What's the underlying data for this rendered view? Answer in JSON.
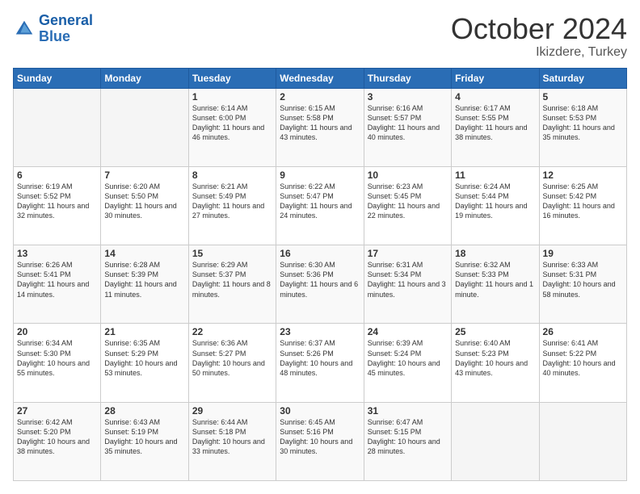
{
  "logo": {
    "line1": "General",
    "line2": "Blue"
  },
  "header": {
    "month": "October 2024",
    "location": "Ikizdere, Turkey"
  },
  "days_of_week": [
    "Sunday",
    "Monday",
    "Tuesday",
    "Wednesday",
    "Thursday",
    "Friday",
    "Saturday"
  ],
  "weeks": [
    [
      {
        "day": "",
        "sunrise": "",
        "sunset": "",
        "daylight": ""
      },
      {
        "day": "",
        "sunrise": "",
        "sunset": "",
        "daylight": ""
      },
      {
        "day": "1",
        "sunrise": "Sunrise: 6:14 AM",
        "sunset": "Sunset: 6:00 PM",
        "daylight": "Daylight: 11 hours and 46 minutes."
      },
      {
        "day": "2",
        "sunrise": "Sunrise: 6:15 AM",
        "sunset": "Sunset: 5:58 PM",
        "daylight": "Daylight: 11 hours and 43 minutes."
      },
      {
        "day": "3",
        "sunrise": "Sunrise: 6:16 AM",
        "sunset": "Sunset: 5:57 PM",
        "daylight": "Daylight: 11 hours and 40 minutes."
      },
      {
        "day": "4",
        "sunrise": "Sunrise: 6:17 AM",
        "sunset": "Sunset: 5:55 PM",
        "daylight": "Daylight: 11 hours and 38 minutes."
      },
      {
        "day": "5",
        "sunrise": "Sunrise: 6:18 AM",
        "sunset": "Sunset: 5:53 PM",
        "daylight": "Daylight: 11 hours and 35 minutes."
      }
    ],
    [
      {
        "day": "6",
        "sunrise": "Sunrise: 6:19 AM",
        "sunset": "Sunset: 5:52 PM",
        "daylight": "Daylight: 11 hours and 32 minutes."
      },
      {
        "day": "7",
        "sunrise": "Sunrise: 6:20 AM",
        "sunset": "Sunset: 5:50 PM",
        "daylight": "Daylight: 11 hours and 30 minutes."
      },
      {
        "day": "8",
        "sunrise": "Sunrise: 6:21 AM",
        "sunset": "Sunset: 5:49 PM",
        "daylight": "Daylight: 11 hours and 27 minutes."
      },
      {
        "day": "9",
        "sunrise": "Sunrise: 6:22 AM",
        "sunset": "Sunset: 5:47 PM",
        "daylight": "Daylight: 11 hours and 24 minutes."
      },
      {
        "day": "10",
        "sunrise": "Sunrise: 6:23 AM",
        "sunset": "Sunset: 5:45 PM",
        "daylight": "Daylight: 11 hours and 22 minutes."
      },
      {
        "day": "11",
        "sunrise": "Sunrise: 6:24 AM",
        "sunset": "Sunset: 5:44 PM",
        "daylight": "Daylight: 11 hours and 19 minutes."
      },
      {
        "day": "12",
        "sunrise": "Sunrise: 6:25 AM",
        "sunset": "Sunset: 5:42 PM",
        "daylight": "Daylight: 11 hours and 16 minutes."
      }
    ],
    [
      {
        "day": "13",
        "sunrise": "Sunrise: 6:26 AM",
        "sunset": "Sunset: 5:41 PM",
        "daylight": "Daylight: 11 hours and 14 minutes."
      },
      {
        "day": "14",
        "sunrise": "Sunrise: 6:28 AM",
        "sunset": "Sunset: 5:39 PM",
        "daylight": "Daylight: 11 hours and 11 minutes."
      },
      {
        "day": "15",
        "sunrise": "Sunrise: 6:29 AM",
        "sunset": "Sunset: 5:37 PM",
        "daylight": "Daylight: 11 hours and 8 minutes."
      },
      {
        "day": "16",
        "sunrise": "Sunrise: 6:30 AM",
        "sunset": "Sunset: 5:36 PM",
        "daylight": "Daylight: 11 hours and 6 minutes."
      },
      {
        "day": "17",
        "sunrise": "Sunrise: 6:31 AM",
        "sunset": "Sunset: 5:34 PM",
        "daylight": "Daylight: 11 hours and 3 minutes."
      },
      {
        "day": "18",
        "sunrise": "Sunrise: 6:32 AM",
        "sunset": "Sunset: 5:33 PM",
        "daylight": "Daylight: 11 hours and 1 minute."
      },
      {
        "day": "19",
        "sunrise": "Sunrise: 6:33 AM",
        "sunset": "Sunset: 5:31 PM",
        "daylight": "Daylight: 10 hours and 58 minutes."
      }
    ],
    [
      {
        "day": "20",
        "sunrise": "Sunrise: 6:34 AM",
        "sunset": "Sunset: 5:30 PM",
        "daylight": "Daylight: 10 hours and 55 minutes."
      },
      {
        "day": "21",
        "sunrise": "Sunrise: 6:35 AM",
        "sunset": "Sunset: 5:29 PM",
        "daylight": "Daylight: 10 hours and 53 minutes."
      },
      {
        "day": "22",
        "sunrise": "Sunrise: 6:36 AM",
        "sunset": "Sunset: 5:27 PM",
        "daylight": "Daylight: 10 hours and 50 minutes."
      },
      {
        "day": "23",
        "sunrise": "Sunrise: 6:37 AM",
        "sunset": "Sunset: 5:26 PM",
        "daylight": "Daylight: 10 hours and 48 minutes."
      },
      {
        "day": "24",
        "sunrise": "Sunrise: 6:39 AM",
        "sunset": "Sunset: 5:24 PM",
        "daylight": "Daylight: 10 hours and 45 minutes."
      },
      {
        "day": "25",
        "sunrise": "Sunrise: 6:40 AM",
        "sunset": "Sunset: 5:23 PM",
        "daylight": "Daylight: 10 hours and 43 minutes."
      },
      {
        "day": "26",
        "sunrise": "Sunrise: 6:41 AM",
        "sunset": "Sunset: 5:22 PM",
        "daylight": "Daylight: 10 hours and 40 minutes."
      }
    ],
    [
      {
        "day": "27",
        "sunrise": "Sunrise: 6:42 AM",
        "sunset": "Sunset: 5:20 PM",
        "daylight": "Daylight: 10 hours and 38 minutes."
      },
      {
        "day": "28",
        "sunrise": "Sunrise: 6:43 AM",
        "sunset": "Sunset: 5:19 PM",
        "daylight": "Daylight: 10 hours and 35 minutes."
      },
      {
        "day": "29",
        "sunrise": "Sunrise: 6:44 AM",
        "sunset": "Sunset: 5:18 PM",
        "daylight": "Daylight: 10 hours and 33 minutes."
      },
      {
        "day": "30",
        "sunrise": "Sunrise: 6:45 AM",
        "sunset": "Sunset: 5:16 PM",
        "daylight": "Daylight: 10 hours and 30 minutes."
      },
      {
        "day": "31",
        "sunrise": "Sunrise: 6:47 AM",
        "sunset": "Sunset: 5:15 PM",
        "daylight": "Daylight: 10 hours and 28 minutes."
      },
      {
        "day": "",
        "sunrise": "",
        "sunset": "",
        "daylight": ""
      },
      {
        "day": "",
        "sunrise": "",
        "sunset": "",
        "daylight": ""
      }
    ]
  ]
}
